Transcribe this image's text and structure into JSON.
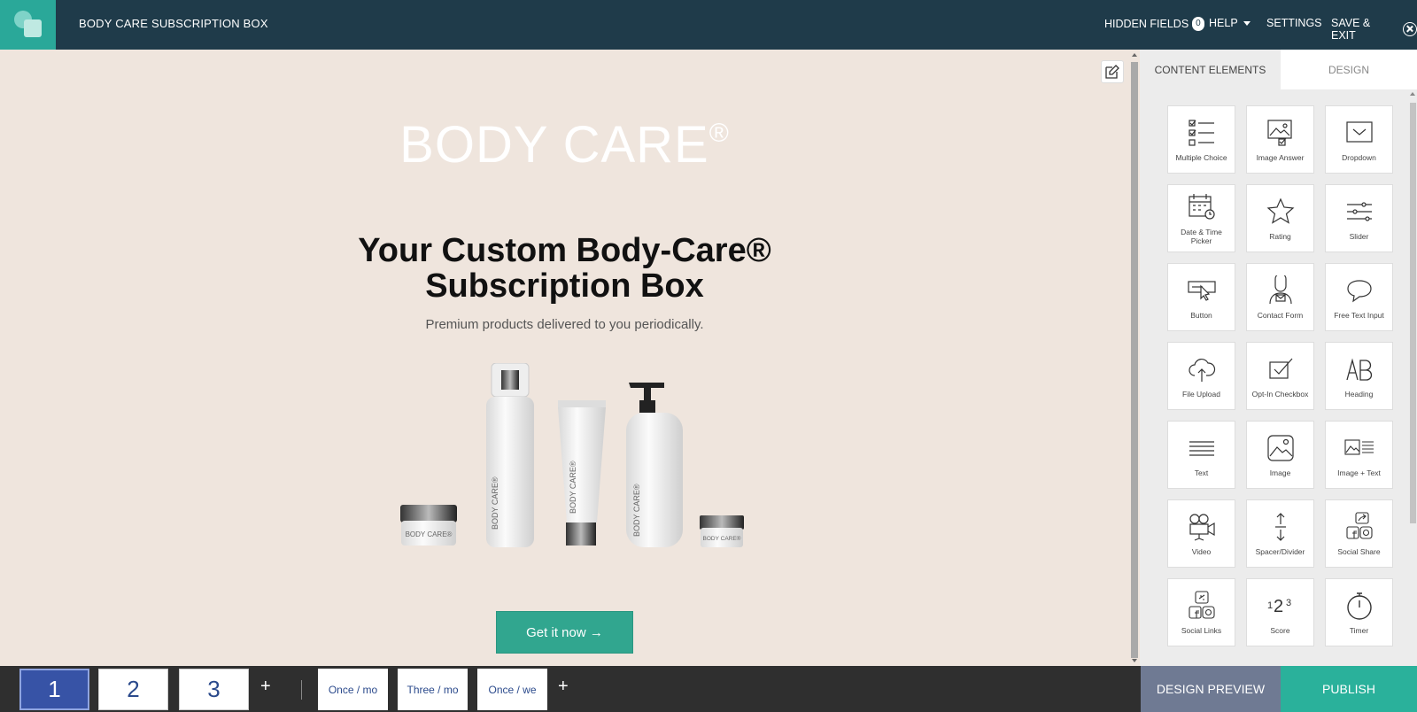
{
  "header": {
    "title": "BODY CARE SUBSCRIPTION BOX",
    "hidden_fields_label": "HIDDEN FIELDS",
    "hidden_fields_count": "0",
    "help_label": "HELP",
    "settings_label": "SETTINGS",
    "save_exit_label": "SAVE & EXIT"
  },
  "canvas": {
    "brand": "BODY CARE",
    "brand_mark": "®",
    "headline_line1": "Your Custom Body-Care®",
    "headline_line2": "Subscription Box",
    "subline": "Premium products delivered to you periodically.",
    "product_label": "BODY CARE®",
    "cta_label": "Get it now →"
  },
  "panel": {
    "tabs": [
      "CONTENT ELEMENTS",
      "DESIGN"
    ],
    "elements": [
      {
        "label": "Multiple Choice",
        "icon": "checklist-icon"
      },
      {
        "label": "Image Answer",
        "icon": "image-answer-icon"
      },
      {
        "label": "Dropdown",
        "icon": "dropdown-icon"
      },
      {
        "label": "Date & Time Picker",
        "icon": "calendar-icon"
      },
      {
        "label": "Rating",
        "icon": "star-icon"
      },
      {
        "label": "Slider",
        "icon": "slider-icon"
      },
      {
        "label": "Button",
        "icon": "button-icon"
      },
      {
        "label": "Contact Form",
        "icon": "contact-icon"
      },
      {
        "label": "Free Text Input",
        "icon": "speech-bubble-icon"
      },
      {
        "label": "File Upload",
        "icon": "cloud-upload-icon"
      },
      {
        "label": "Opt-In Checkbox",
        "icon": "checkbox-icon"
      },
      {
        "label": "Heading",
        "icon": "heading-icon"
      },
      {
        "label": "Text",
        "icon": "text-lines-icon"
      },
      {
        "label": "Image",
        "icon": "image-icon"
      },
      {
        "label": "Image + Text",
        "icon": "image-text-icon"
      },
      {
        "label": "Video",
        "icon": "video-camera-icon"
      },
      {
        "label": "Spacer/Divider",
        "icon": "spacer-icon"
      },
      {
        "label": "Social Share",
        "icon": "share-icon"
      },
      {
        "label": "Social Links",
        "icon": "social-links-icon"
      },
      {
        "label": "Score",
        "icon": "score-icon"
      },
      {
        "label": "Timer",
        "icon": "stopwatch-icon"
      }
    ]
  },
  "footer": {
    "pages": [
      "1",
      "2",
      "3"
    ],
    "add_page": "+",
    "variants": [
      "Once / mo",
      "Three / mo",
      "Once / we"
    ],
    "add_variant": "+",
    "design_preview_label": "DESIGN PREVIEW",
    "publish_label": "PUBLISH"
  }
}
